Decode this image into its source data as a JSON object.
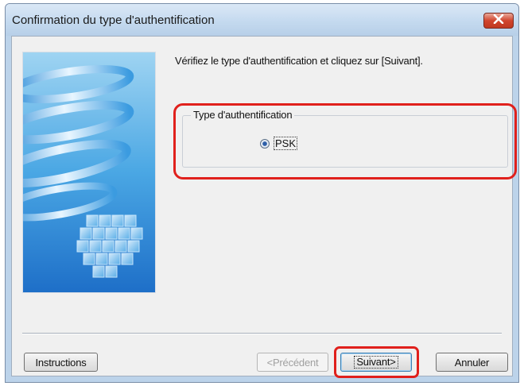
{
  "window": {
    "title": "Confirmation du type d'authentification"
  },
  "titlebar": {
    "close_icon": "close-icon"
  },
  "main": {
    "instruction": "Vérifiez le type d'authentification et cliquez sur [Suivant]."
  },
  "auth_group": {
    "legend": "Type d'authentification",
    "options": [
      {
        "label": "PSK",
        "selected": true
      }
    ]
  },
  "buttons": {
    "instructions": "Instructions",
    "previous": "<Précédent",
    "next": "Suivant>",
    "cancel": "Annuler"
  },
  "colors": {
    "highlight": "#e0201c",
    "title_bar": "#c6dbf0",
    "client_bg": "#f0f0f0"
  }
}
